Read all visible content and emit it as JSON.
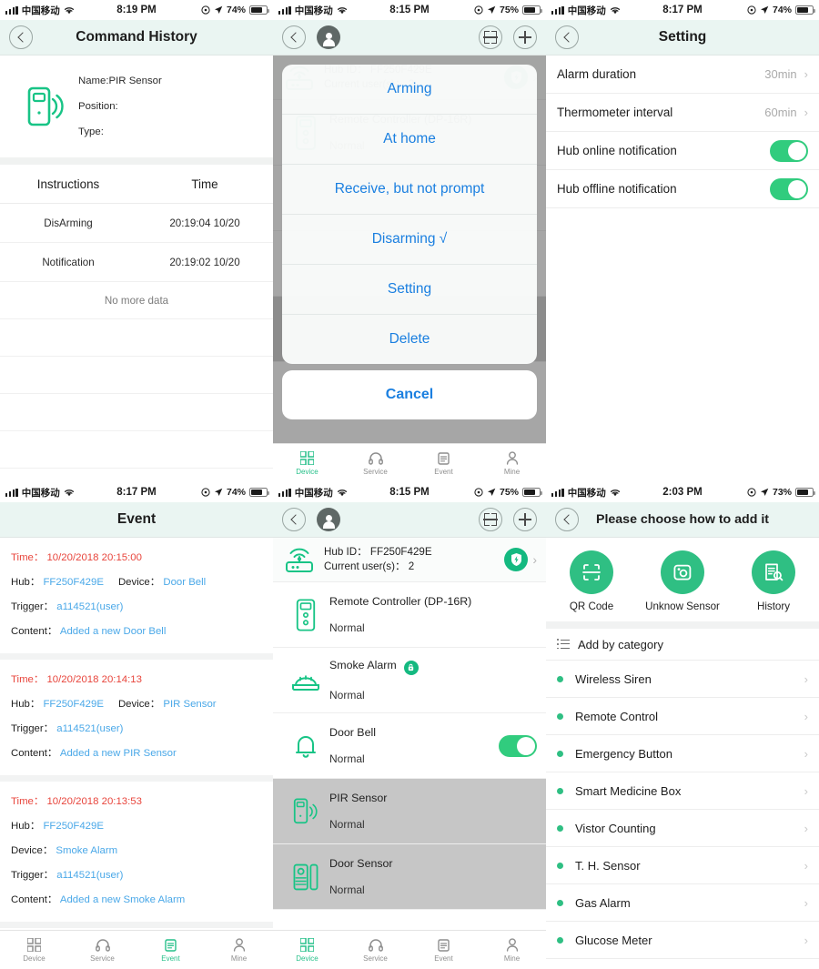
{
  "accent": "#2fbf83",
  "link_blue": "#4aa8e8",
  "ios_blue": "#1a7fe0",
  "alert_red": "#e8453c",
  "statusbar": {
    "carrier": "中国移动",
    "wifi_icon": "wifi-icon",
    "signal_icon": "signal-bars-icon",
    "location_icon": "location-arrow-icon",
    "alarm_icon": "alarm-clock-icon",
    "battery_icon": "battery-icon"
  },
  "panel1": {
    "statusbar": {
      "time": "8:19 PM",
      "battery": "74%"
    },
    "nav": {
      "back_icon": "chevron-left-icon",
      "title": "Command History"
    },
    "device": {
      "icon": "pir-sensor-icon",
      "name_label": "Name:PIR Sensor",
      "position_label": "Position:",
      "type_label": "Type:"
    },
    "table": {
      "headers": [
        "Instructions",
        "Time"
      ],
      "rows": [
        [
          "DisArming",
          "20:19:04 10/20"
        ],
        [
          "Notification",
          "20:19:02 10/20"
        ]
      ],
      "footer": "No more data"
    }
  },
  "panel2": {
    "statusbar": {
      "time": "8:15 PM",
      "battery": "75%"
    },
    "nav": {
      "back_icon": "chevron-left-icon",
      "avatar_icon": "user-avatar-icon",
      "scan_icon": "scan-qr-icon",
      "add_icon": "plus-icon"
    },
    "hub": {
      "icon": "hub-router-icon",
      "id_label": "Hub ID：",
      "id_value": "FF250F429E",
      "users_label": "Current user(s)：",
      "users_value": "2",
      "shield_icon": "shield-bolt-icon",
      "arrow_icon": "chevron-right-icon"
    },
    "devices": [
      {
        "name": "Remote Controller (DP-16R)",
        "state": "Normal",
        "icon": "remote-controller-icon"
      }
    ],
    "actionsheet": {
      "items": [
        "Arming",
        "At home",
        "Receive, but not prompt",
        "Disarming √",
        "Setting",
        "Delete"
      ],
      "cancel": "Cancel"
    },
    "tabs": [
      {
        "label": "Device",
        "icon": "grid-icon",
        "active": true
      },
      {
        "label": "Service",
        "icon": "headset-icon",
        "active": false
      },
      {
        "label": "Event",
        "icon": "clipboard-icon",
        "active": false
      },
      {
        "label": "Mine",
        "icon": "person-icon",
        "active": false
      }
    ]
  },
  "panel3": {
    "statusbar": {
      "time": "8:17 PM",
      "battery": "74%"
    },
    "nav": {
      "back_icon": "chevron-left-icon",
      "title": "Setting"
    },
    "rows": [
      {
        "label": "Alarm duration",
        "value": "30min",
        "type": "link",
        "arrow_icon": "chevron-right-icon"
      },
      {
        "label": "Thermometer interval",
        "value": "60min",
        "type": "link",
        "arrow_icon": "chevron-right-icon"
      },
      {
        "label": "Hub online notification",
        "value": "",
        "type": "toggle",
        "on": true
      },
      {
        "label": "Hub offline notification",
        "value": "",
        "type": "toggle",
        "on": true
      }
    ]
  },
  "panel4": {
    "statusbar": {
      "time": "8:17 PM",
      "battery": "74%"
    },
    "nav": {
      "title": "Event"
    },
    "events": [
      {
        "time_key": "Time：",
        "time_value": "10/20/2018 20:15:00",
        "hub_key": "Hub：",
        "hub_value": "FF250F429E",
        "device_key": "Device：",
        "device_value": "Door Bell",
        "trigger_key": "Trigger：",
        "trigger_value": "a114521(user)",
        "content_key": "Content：",
        "content_value": "Added a new Door Bell",
        "inline": true
      },
      {
        "time_key": "Time：",
        "time_value": "10/20/2018 20:14:13",
        "hub_key": "Hub：",
        "hub_value": "FF250F429E",
        "device_key": "Device：",
        "device_value": "PIR Sensor",
        "trigger_key": "Trigger：",
        "trigger_value": "a114521(user)",
        "content_key": "Content：",
        "content_value": "Added a new PIR Sensor",
        "inline": true
      },
      {
        "time_key": "Time：",
        "time_value": "10/20/2018 20:13:53",
        "hub_key": "Hub：",
        "hub_value": "FF250F429E",
        "device_key": "Device：",
        "device_value": "Smoke Alarm",
        "trigger_key": "Trigger：",
        "trigger_value": "a114521(user)",
        "content_key": "Content：",
        "content_value": "Added a new Smoke Alarm",
        "inline": false
      }
    ],
    "tabs": [
      {
        "label": "Device",
        "icon": "grid-icon",
        "active": false
      },
      {
        "label": "Service",
        "icon": "headset-icon",
        "active": false
      },
      {
        "label": "Event",
        "icon": "clipboard-icon",
        "active": true
      },
      {
        "label": "Mine",
        "icon": "person-icon",
        "active": false
      }
    ]
  },
  "panel5": {
    "statusbar": {
      "time": "8:15 PM",
      "battery": "75%"
    },
    "nav": {
      "back_icon": "chevron-left-icon",
      "avatar_icon": "user-avatar-icon",
      "scan_icon": "scan-qr-icon",
      "add_icon": "plus-icon"
    },
    "hub": {
      "icon": "hub-router-icon",
      "id_label": "Hub ID：",
      "id_value": "FF250F429E",
      "users_label": "Current user(s)：",
      "users_value": "2",
      "shield_icon": "shield-bolt-icon",
      "arrow_icon": "chevron-right-icon"
    },
    "devices": [
      {
        "name": "Remote Controller (DP-16R)",
        "state": "Normal",
        "icon": "remote-controller-icon",
        "badge": false,
        "toggle": false,
        "shaded": false
      },
      {
        "name": "Smoke Alarm",
        "state": "Normal",
        "icon": "smoke-alarm-icon",
        "badge": true,
        "toggle": false,
        "shaded": false
      },
      {
        "name": "Door Bell",
        "state": "Normal",
        "icon": "door-bell-icon",
        "badge": false,
        "toggle": true,
        "shaded": false
      },
      {
        "name": "PIR Sensor",
        "state": "Normal",
        "icon": "pir-sensor-icon",
        "badge": false,
        "toggle": false,
        "shaded": true
      },
      {
        "name": "Door Sensor",
        "state": "Normal",
        "icon": "door-sensor-icon",
        "badge": false,
        "toggle": false,
        "shaded": true
      }
    ],
    "tabs": [
      {
        "label": "Device",
        "icon": "grid-icon",
        "active": true
      },
      {
        "label": "Service",
        "icon": "headset-icon",
        "active": false
      },
      {
        "label": "Event",
        "icon": "clipboard-icon",
        "active": false
      },
      {
        "label": "Mine",
        "icon": "person-icon",
        "active": false
      }
    ]
  },
  "panel6": {
    "statusbar": {
      "time": "2:03 PM",
      "battery": "73%"
    },
    "nav": {
      "back_icon": "chevron-left-icon",
      "title": "Please choose how to add it"
    },
    "methods": [
      {
        "label": "QR Code",
        "icon": "qr-scan-icon"
      },
      {
        "label": "Unknow Sensor",
        "icon": "unknown-sensor-icon"
      },
      {
        "label": "History",
        "icon": "history-doc-icon"
      }
    ],
    "category_header": "Add by category",
    "categories": [
      "Wireless Siren",
      "Remote Control",
      "Emergency Button",
      "Smart Medicine Box",
      "Vistor Counting",
      "T. H. Sensor",
      "Gas Alarm",
      "Glucose Meter"
    ]
  }
}
